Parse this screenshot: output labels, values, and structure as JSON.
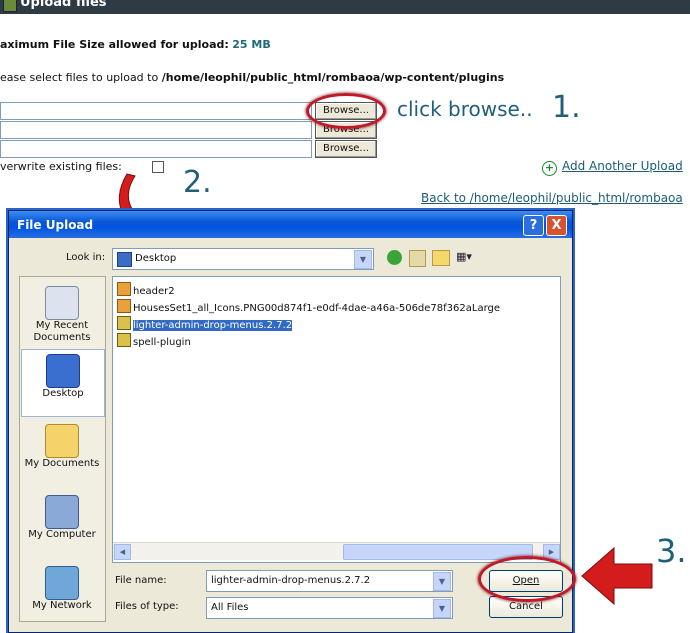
{
  "page": {
    "title": "Upload files",
    "max_size_label": "aximum File Size allowed for upload:",
    "max_size_value": "25 MB",
    "select_label": "ease select files to upload to",
    "select_path": "/home/leophil/public_html/rombaoa/wp-content/plugins",
    "browse_label": "Browse...",
    "overwrite_label": "verwrite existing files:",
    "add_another": "Add Another Upload",
    "back_link": "Back to /home/leophil/public_html/rombaoa"
  },
  "annotations": {
    "step1_text": "click browse..",
    "step1_num": "1.",
    "step2_num": "2.",
    "step3_num": "3."
  },
  "dialog": {
    "title": "File Upload",
    "help_label": "?",
    "close_label": "X",
    "look_in_label": "Look in:",
    "look_in_value": "Desktop",
    "places": [
      {
        "label": "My Recent Documents",
        "icon": "recent-documents-icon"
      },
      {
        "label": "Desktop",
        "icon": "desktop-icon"
      },
      {
        "label": "My Documents",
        "icon": "my-documents-icon"
      },
      {
        "label": "My Computer",
        "icon": "my-computer-icon"
      },
      {
        "label": "My Network",
        "icon": "my-network-icon"
      }
    ],
    "files": [
      {
        "name": "header2",
        "icon": "image-file-icon",
        "selected": false
      },
      {
        "name": "HousesSet1_all_Icons.PNG00d874f1-e0df-4dae-a46a-506de78f362aLarge",
        "icon": "image-file-icon",
        "selected": false
      },
      {
        "name": "lighter-admin-drop-menus.2.7.2",
        "icon": "zip-folder-icon",
        "selected": true
      },
      {
        "name": "spell-plugin",
        "icon": "zip-folder-icon",
        "selected": false
      }
    ],
    "file_name_label": "File name:",
    "file_name_value": "lighter-admin-drop-menus.2.7.2",
    "file_type_label": "Files of type:",
    "file_type_value": "All Files",
    "open_label": "Open",
    "cancel_label": "Cancel"
  }
}
